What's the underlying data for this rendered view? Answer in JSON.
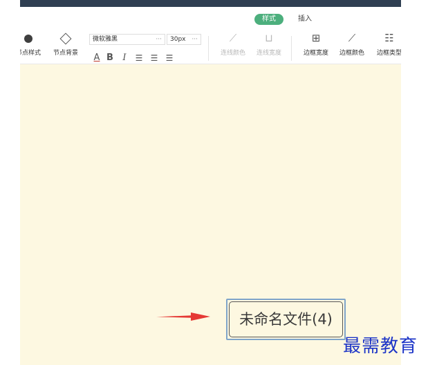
{
  "tabs": {
    "style": "样式",
    "insert": "插入"
  },
  "tools": {
    "node_style": "节点样式",
    "node_bg": "节点背景",
    "line_color": "连线颜色",
    "line_width": "连线宽度",
    "border_width": "边框宽度",
    "border_color": "边框颜色",
    "border_type": "边框类型"
  },
  "font": {
    "family": "微软雅黑",
    "size": "30px",
    "more": "···"
  },
  "format": {
    "color": "A",
    "bold": "B",
    "italic": "I",
    "align_left": "☰",
    "align_center": "☰",
    "align_right": "☰"
  },
  "node": {
    "text": "未命名文件(4)"
  },
  "watermark": "最需教育",
  "colors": {
    "accent": "#4caf7d",
    "canvas_bg": "#fdf8e1",
    "arrow": "#e53935",
    "watermark": "#1d35c7",
    "topbar": "#2f3f52"
  }
}
